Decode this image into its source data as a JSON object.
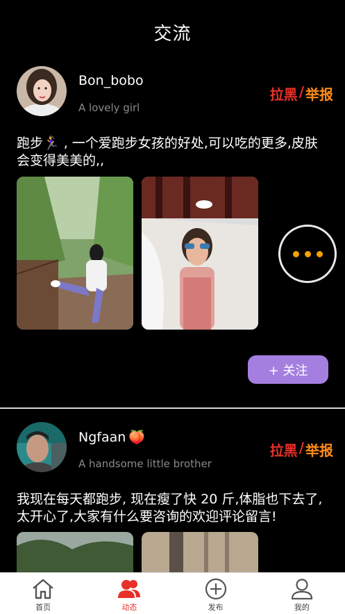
{
  "header": {
    "title": "交流"
  },
  "posts": [
    {
      "username": "Bon_bobo",
      "username_emoji": "",
      "bio": "A lovely girl",
      "block_label": "拉黑",
      "separator": "/",
      "report_label": "举报",
      "content": "跑步🏃‍♀️ , 一个爱跑步女孩的好处,可以吃的更多,皮肤会变得美美的,,",
      "follow_label": "+ 关注"
    },
    {
      "username": "Ngfaan",
      "username_emoji": "🍑",
      "bio": "A handsome little brother",
      "block_label": "拉黑",
      "separator": "/",
      "report_label": "举报",
      "content": "我现在每天都跑步, 现在瘦了快 20 斤,体脂也下去了,太开心了,大家有什么要咨询的欢迎评论留言!"
    }
  ],
  "tabbar": {
    "items": [
      {
        "label": "首页",
        "icon": "home-icon"
      },
      {
        "label": "动态",
        "icon": "users-icon"
      },
      {
        "label": "发布",
        "icon": "plus-circle-icon"
      },
      {
        "label": "我的",
        "icon": "user-icon"
      }
    ]
  },
  "colors": {
    "accent": "#e8302a",
    "report": "#ff8c1a",
    "follow": "#a57fe0",
    "more_dots": "#f5a100"
  }
}
